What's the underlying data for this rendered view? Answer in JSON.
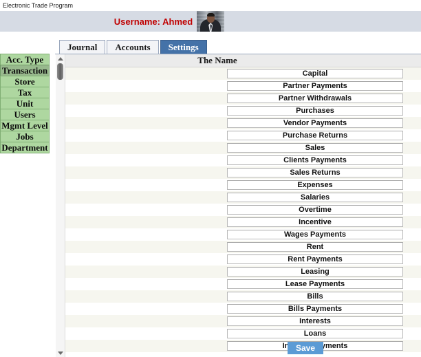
{
  "document": {
    "title": "Electronic Trade Program"
  },
  "header": {
    "username_label": "Username: Ahmed",
    "avatar_icon": "user-photo",
    "band_color": "#d6dbe4",
    "username_color": "#c00000"
  },
  "tabs": [
    {
      "label": "Journal",
      "active": false
    },
    {
      "label": "Accounts",
      "active": false
    },
    {
      "label": "Settings",
      "active": true
    }
  ],
  "sidebar": {
    "items": [
      {
        "label": "Acc. Type",
        "selected": false
      },
      {
        "label": "Transaction",
        "selected": true
      },
      {
        "label": "Store",
        "selected": false
      },
      {
        "label": "Tax",
        "selected": false
      },
      {
        "label": "Unit",
        "selected": false
      },
      {
        "label": "Users",
        "selected": false
      },
      {
        "label": "Mgmt Level",
        "selected": false
      },
      {
        "label": "Jobs",
        "selected": false
      },
      {
        "label": "Department",
        "selected": false
      }
    ],
    "button_color": "#aed7a0",
    "selected_color": "#98b98d"
  },
  "grid": {
    "column_header": "The Name",
    "rows": [
      {
        "name": "Capital"
      },
      {
        "name": "Partner Payments"
      },
      {
        "name": "Partner Withdrawals"
      },
      {
        "name": "Purchases"
      },
      {
        "name": "Vendor Payments"
      },
      {
        "name": "Purchase Returns"
      },
      {
        "name": "Sales"
      },
      {
        "name": "Clients Payments"
      },
      {
        "name": "Sales Returns"
      },
      {
        "name": "Expenses"
      },
      {
        "name": "Salaries"
      },
      {
        "name": "Overtime"
      },
      {
        "name": "Incentive"
      },
      {
        "name": "Wages Payments"
      },
      {
        "name": "Rent"
      },
      {
        "name": "Rent Payments"
      },
      {
        "name": "Leasing"
      },
      {
        "name": "Lease Payments"
      },
      {
        "name": "Bills"
      },
      {
        "name": "Bills Payments"
      },
      {
        "name": "Interests"
      },
      {
        "name": "Loans"
      },
      {
        "name": "Interest Payments"
      }
    ]
  },
  "scrollbar": {
    "up_arrow_icon": "triangle-up-icon",
    "down_arrow_icon": "triangle-down-icon"
  },
  "footer": {
    "save_label": "Save",
    "save_color": "#5b9bd5"
  }
}
